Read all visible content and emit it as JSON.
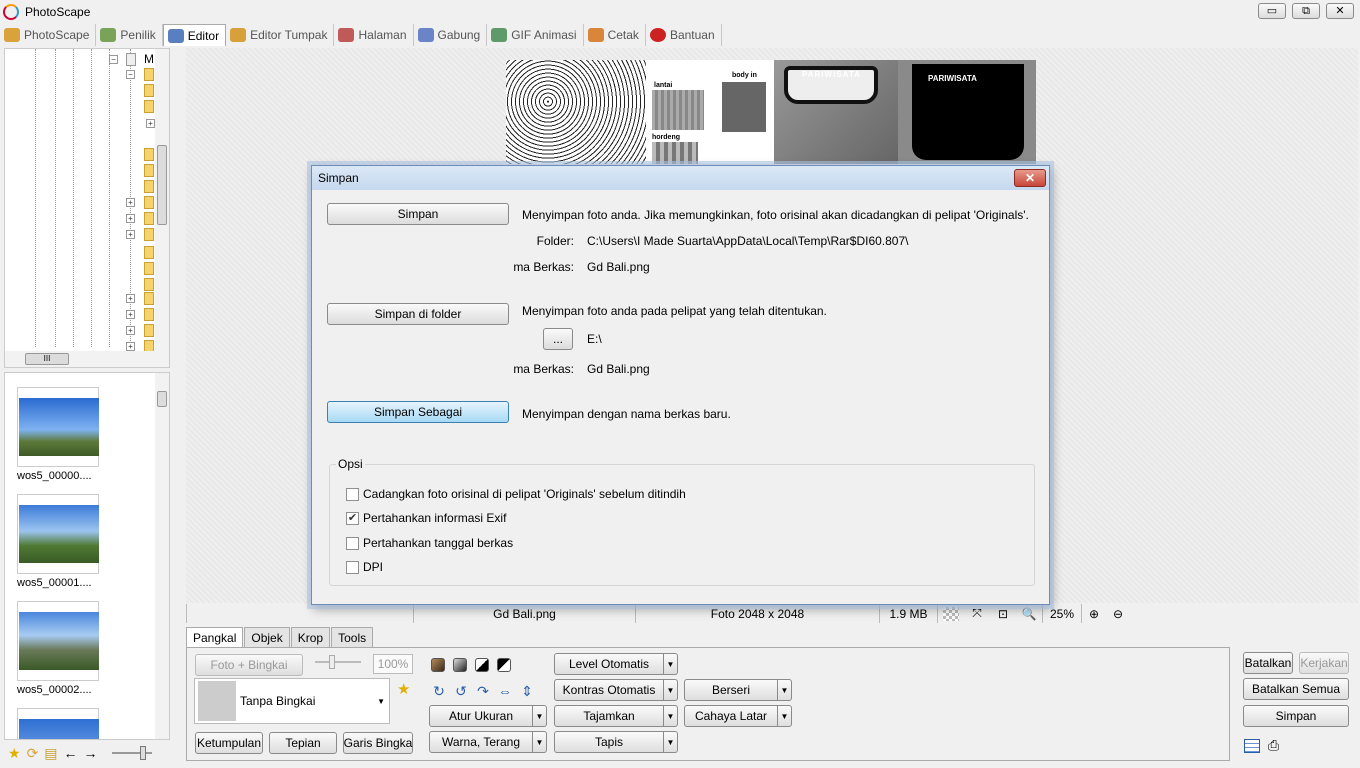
{
  "window": {
    "title": "PhotoScape",
    "controls": {
      "minimize": "▭",
      "restore": "⧉",
      "close": "✕"
    }
  },
  "main_tabs": [
    {
      "label": "PhotoScape",
      "icon": "photoscape-icon",
      "color": "#d9a23a"
    },
    {
      "label": "Penilik",
      "icon": "viewer-icon",
      "color": "#7aa35a"
    },
    {
      "label": "Editor",
      "icon": "editor-icon",
      "color": "#5a7fc0",
      "active": true
    },
    {
      "label": "Editor Tumpak",
      "icon": "batch-editor-icon",
      "color": "#d7a03a"
    },
    {
      "label": "Halaman",
      "icon": "page-icon",
      "color": "#c05a5a"
    },
    {
      "label": "Gabung",
      "icon": "combine-icon",
      "color": "#6a84c7"
    },
    {
      "label": "GIF Animasi",
      "icon": "gif-icon",
      "color": "#5e9a6a"
    },
    {
      "label": "Cetak",
      "icon": "print-icon",
      "color": "#d9863a"
    },
    {
      "label": "Bantuan",
      "icon": "help-icon",
      "color": "#cc2222"
    }
  ],
  "tree": {
    "top_item_label": "M"
  },
  "thumbnails": [
    {
      "label": "wos5_00000...."
    },
    {
      "label": "wos5_00001...."
    },
    {
      "label": "wos5_00002...."
    }
  ],
  "canvas": {
    "strip_texts": {
      "lantai": "lantai",
      "body_in": "body in",
      "hordeng": "hordeng",
      "pariwisata": "PARIWISATA",
      "every": "EVERY"
    }
  },
  "status": {
    "filename": "Gd Bali.png",
    "dimensions": "Foto 2048 x 2048",
    "size": "1.9 MB",
    "zoom": "25%"
  },
  "dialog": {
    "title": "Simpan",
    "close": "✕",
    "simpan_button": "Simpan",
    "simpan_desc": "Menyimpan foto anda. Jika memungkinkan, foto orisinal akan dicadangkan di pelipat 'Originals'.",
    "folder_label": "Folder:",
    "folder_value": "C:\\Users\\I Made Suarta\\AppData\\Local\\Temp\\Rar$DI60.807\\",
    "name_label": "ma Berkas:",
    "name_value": "Gd Bali.png",
    "simpan_folder_button": "Simpan di folder",
    "simpan_folder_desc": "Menyimpan foto anda pada pelipat yang telah ditentukan.",
    "browse_button": "...",
    "folder2_value": "E:\\",
    "name2_label": "ma Berkas:",
    "name2_value": "Gd Bali.png",
    "simpan_sebagai_button": "Simpan Sebagai",
    "simpan_sebagai_desc": "Menyimpan dengan nama berkas baru.",
    "opsi_label": "Opsi",
    "options": [
      {
        "label": "Cadangkan foto orisinal di pelipat 'Originals' sebelum ditindih",
        "checked": false
      },
      {
        "label": "Pertahankan informasi Exif",
        "checked": true
      },
      {
        "label": "Pertahankan tanggal berkas",
        "checked": false
      },
      {
        "label": "DPI",
        "checked": false
      }
    ]
  },
  "tool_tabs": [
    "Pangkal",
    "Objek",
    "Krop",
    "Tools"
  ],
  "tools": {
    "foto_bingkai": "Foto + Bingkai",
    "zoom_pct": "100%",
    "frame_name": "Tanpa Bingkai",
    "ketumpulan": "Ketumpulan",
    "tepian": "Tepian",
    "garis_bingkai": "Garis Bingka",
    "atur_ukuran": "Atur Ukuran",
    "warna_terang": "Warna, Terang",
    "level_otomatis": "Level Otomatis",
    "kontras_otomatis": "Kontras Otomatis",
    "tajamkan": "Tajamkan",
    "tapis": "Tapis",
    "berseri": "Berseri",
    "cahaya_latar": "Cahaya Latar",
    "dropdown_arrow": "▼"
  },
  "right_panel": {
    "batalkan": "Batalkan",
    "kerjakan": "Kerjakan",
    "batalkan_semua": "Batalkan Semua",
    "simpan": "Simpan"
  }
}
